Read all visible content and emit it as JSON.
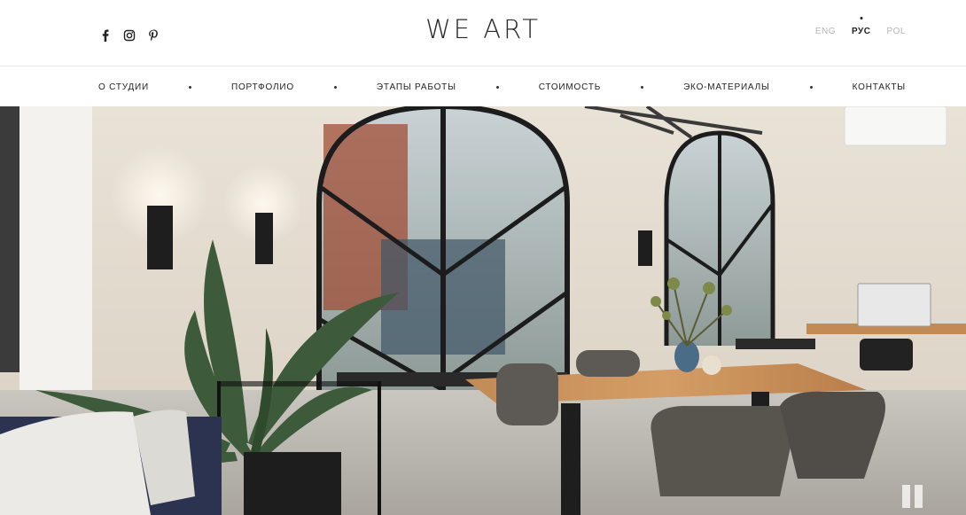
{
  "brand": {
    "logo": "WE ART"
  },
  "social": {
    "items": [
      {
        "icon": "facebook-icon"
      },
      {
        "icon": "instagram-icon"
      },
      {
        "icon": "pinterest-icon"
      }
    ]
  },
  "languages": {
    "items": [
      {
        "label": "ENG",
        "active": false
      },
      {
        "label": "РУС",
        "active": true
      },
      {
        "label": "POL",
        "active": false
      }
    ]
  },
  "nav": {
    "items": [
      {
        "label": "О СТУДИИ"
      },
      {
        "label": "ПОРТФОЛИО"
      },
      {
        "label": "ЭТАПЫ РАБОТЫ"
      },
      {
        "label": "СТОИМОСТЬ"
      },
      {
        "label": "ЭКО-МАТЕРИАЛЫ"
      },
      {
        "label": "КОНТАКТЫ"
      }
    ]
  },
  "hero": {
    "media": "video",
    "controls": {
      "pause_icon": "pause-icon"
    }
  },
  "colors": {
    "text": "#222222",
    "muted": "#b5b5b5",
    "background": "#ffffff"
  }
}
